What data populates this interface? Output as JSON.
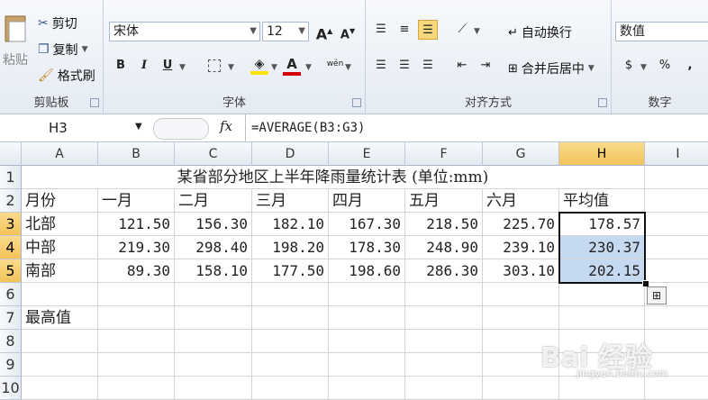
{
  "ribbon": {
    "clipboard": {
      "paste": "粘贴",
      "cut": "剪切",
      "copy": "复制",
      "format_painter": "格式刷",
      "label": "剪贴板"
    },
    "font": {
      "family": "宋体",
      "size": "12",
      "label": "字体",
      "bold": "B",
      "italic": "I",
      "underline": "U",
      "grow": "A",
      "shrink": "A",
      "phonetic": "wén"
    },
    "alignment": {
      "wrap": "自动换行",
      "merge": "合并后居中",
      "label": "对齐方式"
    },
    "number": {
      "format": "数值",
      "percent": "%",
      "comma": ",",
      "label": "数字"
    },
    "colors": {
      "fill": "#ffe600",
      "font": "#d40000",
      "accent_active": "#f8d77d"
    }
  },
  "formula_bar": {
    "cell": "H3",
    "fx": "fx",
    "formula": "=AVERAGE(B3:G3)"
  },
  "columns": [
    "A",
    "B",
    "C",
    "D",
    "E",
    "F",
    "G",
    "H",
    "I"
  ],
  "rows": [
    "1",
    "2",
    "3",
    "4",
    "5",
    "6",
    "7",
    "8",
    "9",
    "10"
  ],
  "sheet": {
    "title": "某省部分地区上半年降雨量统计表 (单位:mm)",
    "headers": [
      "月份",
      "一月",
      "二月",
      "三月",
      "四月",
      "五月",
      "六月",
      "平均值"
    ],
    "data": [
      [
        "北部",
        "121.50",
        "156.30",
        "182.10",
        "167.30",
        "218.50",
        "225.70",
        "178.57"
      ],
      [
        "中部",
        "219.30",
        "298.40",
        "198.20",
        "178.30",
        "248.90",
        "239.10",
        "230.37"
      ],
      [
        "南部",
        "89.30",
        "158.10",
        "177.50",
        "198.60",
        "286.30",
        "303.10",
        "202.15"
      ]
    ],
    "row7_label": "最高值"
  },
  "watermark": {
    "main": "Bai 经验",
    "sub": "jingyan.baidu.com"
  }
}
